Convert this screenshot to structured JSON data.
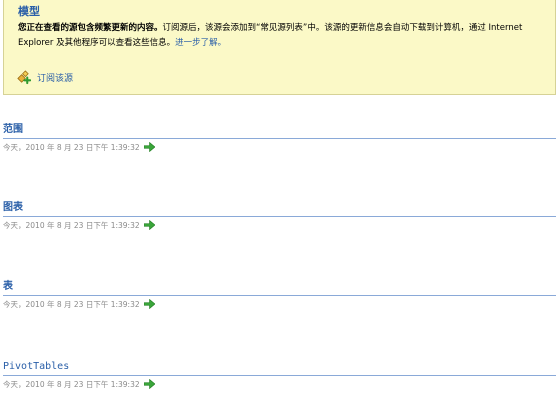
{
  "banner": {
    "title": "模型",
    "description_bold": "您正在查看的源包含频繁更新的内容。",
    "description_text": "订阅源后，该源会添加到“常见源列表”中。该源的更新信息会自动下载到计算机，通过 Internet Explorer 及其他程序可以查看这些信息。",
    "learn_more_link": "进一步了解。",
    "subscribe_label": "订阅该源"
  },
  "items": [
    {
      "title": "范围",
      "date": "今天，2010 年 8 月 23 日下午 1:39:32"
    },
    {
      "title": "图表",
      "date": "今天，2010 年 8 月 23 日下午 1:39:32"
    },
    {
      "title": "表",
      "date": "今天，2010 年 8 月 23 日下午 1:39:32"
    },
    {
      "title": "PivotTables",
      "date": "今天，2010 年 8 月 23 日下午 1:39:32"
    }
  ],
  "colors": {
    "banner_bg": "#fbf9c7",
    "link": "#2a5fa8",
    "rule": "#8aa9d8",
    "arrow": "#3aa53a"
  },
  "icons": {
    "subscribe": "feed-subscribe-icon",
    "go": "green-arrow-icon"
  }
}
